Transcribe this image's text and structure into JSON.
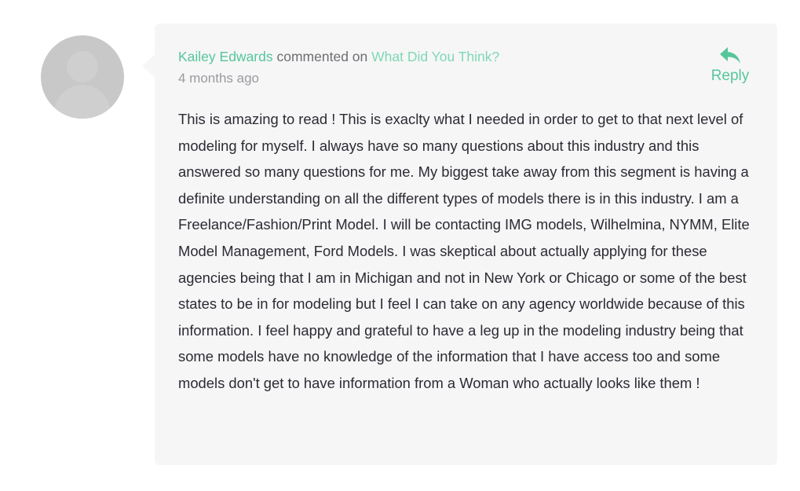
{
  "comment": {
    "author": "Kailey Edwards",
    "action_text": "commented on",
    "post_title": "What Did You Think?",
    "timestamp": "4 months ago",
    "reply_label": "Reply",
    "reply_icon": "reply-arrow-icon",
    "avatar_icon": "default-user-avatar",
    "body": "This is amazing to read ! This is exaclty what I needed in order to get to that next level of modeling for myself. I always have so many questions about this industry and this answered so many questions for me. My biggest take away from this segment is having a definite understanding on all the different types of models there is in this industry. I am a Freelance/Fashion/Print Model. I will be contacting IMG models, Wilhelmina, NYMM, Elite Model Management, Ford Models. I was skeptical about actually applying for these agencies being that I am in Michigan and not in New York or Chicago or some of the best states to be in for modeling but I feel I can take on any agency worldwide because of this information. I feel happy and grateful to have a leg up in the modeling industry being that some models have no knowledge of the information that I have access too and some models don't get to have information from a Woman who actually looks like them !"
  },
  "colors": {
    "accent": "#55c69a",
    "link_light": "#7fd8b3",
    "card_background": "#f6f6f7",
    "text": "#2b2b33",
    "muted": "#9a9a9f"
  }
}
